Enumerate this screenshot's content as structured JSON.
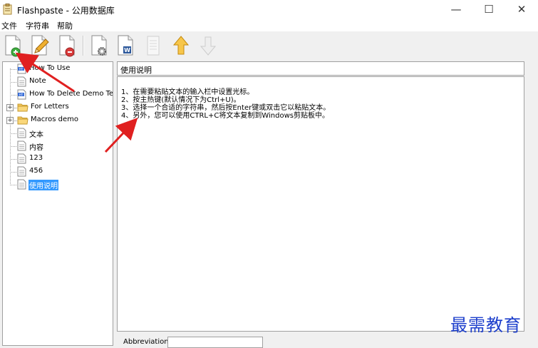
{
  "window": {
    "title": "Flashpaste - 公用数据库",
    "minimize_glyph": "—",
    "maximize_glyph": "☐",
    "close_glyph": "✕"
  },
  "menu": [
    "文件",
    "字符串",
    "帮助"
  ],
  "toolbar": {
    "icons": [
      "new-item-icon",
      "edit-icon",
      "delete-icon",
      "settings-icon",
      "word-icon",
      "list-icon",
      "move-up-icon",
      "move-down-icon"
    ]
  },
  "tree": {
    "items": [
      {
        "label": "How To Use",
        "icon": "html-doc"
      },
      {
        "label": "Note",
        "icon": "doc"
      },
      {
        "label": "How To Delete Demo Text",
        "icon": "html-doc"
      },
      {
        "label": "For Letters",
        "icon": "folder",
        "expander": "+"
      },
      {
        "label": "Macros demo",
        "icon": "folder",
        "expander": "+"
      },
      {
        "label": "文本",
        "icon": "doc"
      },
      {
        "label": "内容",
        "icon": "doc"
      },
      {
        "label": "123",
        "icon": "doc"
      },
      {
        "label": "456",
        "icon": "doc"
      },
      {
        "label": "使用说明",
        "icon": "doc",
        "selected": true
      }
    ]
  },
  "editor": {
    "title": "使用说明",
    "lines": [
      "1、在需要粘贴文本的输入栏中设置光标。",
      "2、按主热键(默认情况下为Ctrl+U)。",
      "3、选择一个合适的字符串，然后按Enter键或双击它以粘贴文本。",
      "4、另外，您可以使用CTRL+C将文本复制到Windows剪贴板中。"
    ]
  },
  "abbreviation": {
    "label": "Abbreviation:",
    "value": ""
  },
  "watermark": "最需教育",
  "colors": {
    "selection": "#3399ff",
    "annotation_arrow": "#e02020",
    "watermark": "#1d3fcc"
  }
}
